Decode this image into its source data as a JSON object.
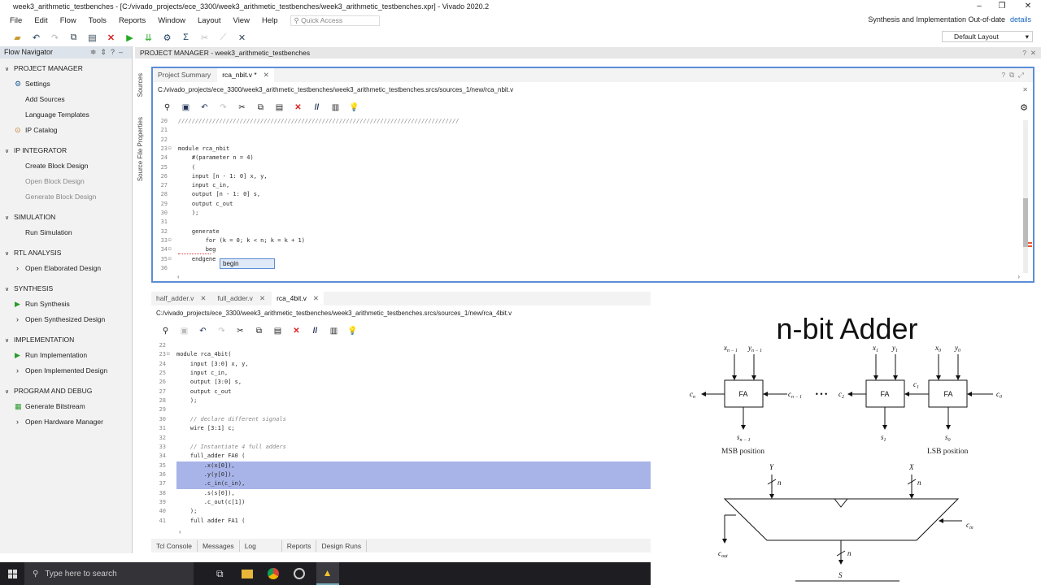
{
  "window": {
    "title": "week3_arithmetic_testbenches - [C:/vivado_projects/ece_3300/week3_arithmetic_testbenches/week3_arithmetic_testbenches.xpr] - Vivado 2020.2",
    "status": "Synthesis and Implementation Out-of-date",
    "status_link": "details",
    "min": "–",
    "restore": "❐",
    "close": "✕"
  },
  "menu": [
    "File",
    "Edit",
    "Flow",
    "Tools",
    "Reports",
    "Window",
    "Layout",
    "View",
    "Help"
  ],
  "quick_access": {
    "placeholder": "Quick Access"
  },
  "layout_select": "Default Layout",
  "flow_navigator": {
    "title": "Flow Navigator",
    "sections": [
      {
        "label": "PROJECT MANAGER",
        "items": [
          {
            "label": "Settings",
            "icon": "gear-icon"
          },
          {
            "label": "Add Sources"
          },
          {
            "label": "Language Templates"
          },
          {
            "label": "IP Catalog",
            "icon": "ip-icon"
          }
        ]
      },
      {
        "label": "IP INTEGRATOR",
        "items": [
          {
            "label": "Create Block Design"
          },
          {
            "label": "Open Block Design",
            "disabled": true
          },
          {
            "label": "Generate Block Design",
            "disabled": true
          }
        ]
      },
      {
        "label": "SIMULATION",
        "items": [
          {
            "label": "Run Simulation"
          }
        ]
      },
      {
        "label": "RTL ANALYSIS",
        "items": [
          {
            "label": "Open Elaborated Design",
            "caret": true
          }
        ]
      },
      {
        "label": "SYNTHESIS",
        "items": [
          {
            "label": "Run Synthesis",
            "icon": "play-icon"
          },
          {
            "label": "Open Synthesized Design",
            "caret": true
          }
        ]
      },
      {
        "label": "IMPLEMENTATION",
        "items": [
          {
            "label": "Run Implementation",
            "icon": "play-icon"
          },
          {
            "label": "Open Implemented Design",
            "caret": true
          }
        ]
      },
      {
        "label": "PROGRAM AND DEBUG",
        "items": [
          {
            "label": "Generate Bitstream",
            "icon": "bitstream-icon"
          },
          {
            "label": "Open Hardware Manager",
            "caret": true
          }
        ]
      }
    ]
  },
  "project_manager": {
    "header": "PROJECT MANAGER - week3_arithmetic_testbenches"
  },
  "side_tabs": [
    "Sources",
    "Source File Properties"
  ],
  "editor1": {
    "tabs": [
      {
        "label": "Project Summary",
        "active": false
      },
      {
        "label": "rca_nbit.v *",
        "active": true
      }
    ],
    "path": "C:/vivado_projects/ece_3300/week3_arithmetic_testbenches/week3_arithmetic_testbenches.srcs/sources_1/new/rca_nbit.v",
    "lines": [
      {
        "n": "20",
        "t": "//////////////////////////////////////////////////////////////////////////////////",
        "c": "cm"
      },
      {
        "n": "21",
        "t": ""
      },
      {
        "n": "22",
        "t": ""
      },
      {
        "n": "23",
        "t": "module rca_nbit",
        "f": true
      },
      {
        "n": "24",
        "t": "    #(parameter n = 4)"
      },
      {
        "n": "25",
        "t": "    ("
      },
      {
        "n": "26",
        "t": "    input [n - 1: 0] x, y,"
      },
      {
        "n": "27",
        "t": "    input c_in,"
      },
      {
        "n": "28",
        "t": "    output [n - 1: 0] s,"
      },
      {
        "n": "29",
        "t": "    output c_out"
      },
      {
        "n": "30",
        "t": "    );"
      },
      {
        "n": "31",
        "t": ""
      },
      {
        "n": "32",
        "t": "    generate"
      },
      {
        "n": "33",
        "t": "        for (k = 0; k < n; k = k + 1)",
        "f": true
      },
      {
        "n": "34",
        "t": "        beg",
        "f": true
      },
      {
        "n": "35",
        "t": "    endgene",
        "f": true
      },
      {
        "n": "36",
        "t": ""
      }
    ],
    "autocomplete": "begin"
  },
  "editor2": {
    "tabs": [
      {
        "label": "half_adder.v",
        "active": false
      },
      {
        "label": "full_adder.v",
        "active": false
      },
      {
        "label": "rca_4bit.v",
        "active": true
      }
    ],
    "path": "C:/vivado_projects/ece_3300/week3_arithmetic_testbenches/week3_arithmetic_testbenches.srcs/sources_1/new/rca_4bit.v",
    "lines": [
      {
        "n": "22",
        "t": ""
      },
      {
        "n": "23",
        "t": "module rca_4bit(",
        "f": true
      },
      {
        "n": "24",
        "t": "    input [3:0] x, y,"
      },
      {
        "n": "25",
        "t": "    input c_in,"
      },
      {
        "n": "26",
        "t": "    output [3:0] s,"
      },
      {
        "n": "27",
        "t": "    output c_out"
      },
      {
        "n": "28",
        "t": "    );"
      },
      {
        "n": "29",
        "t": ""
      },
      {
        "n": "30",
        "t": "    // declare different signals",
        "c": "cm"
      },
      {
        "n": "31",
        "t": "    wire [3:1] c;"
      },
      {
        "n": "32",
        "t": ""
      },
      {
        "n": "33",
        "t": "    // Instantiate 4 full adders",
        "c": "cm"
      },
      {
        "n": "34",
        "t": "    full_adder FA0 ("
      },
      {
        "n": "35",
        "t": "        .x(x[0]),",
        "hl": true
      },
      {
        "n": "36",
        "t": "        .y(y[0]),",
        "hl": true
      },
      {
        "n": "37",
        "t": "        .c_in(c_in),",
        "hl": true
      },
      {
        "n": "38",
        "t": "        .s(s[0]),"
      },
      {
        "n": "39",
        "t": "        .c_out(c[1])"
      },
      {
        "n": "40",
        "t": "    );"
      },
      {
        "n": "41",
        "t": "    full_adder FA1 ("
      }
    ]
  },
  "bottom_tabs": [
    "Tcl Console",
    "Messages",
    "Log",
    "Reports",
    "Design Runs"
  ],
  "taskbar": {
    "search_placeholder": "Type here to search"
  },
  "diagram": {
    "title": "n-bit Adder",
    "fa": "FA",
    "msb_label": "MSB position",
    "lsb_label": "LSB position",
    "dots": "• • •"
  }
}
